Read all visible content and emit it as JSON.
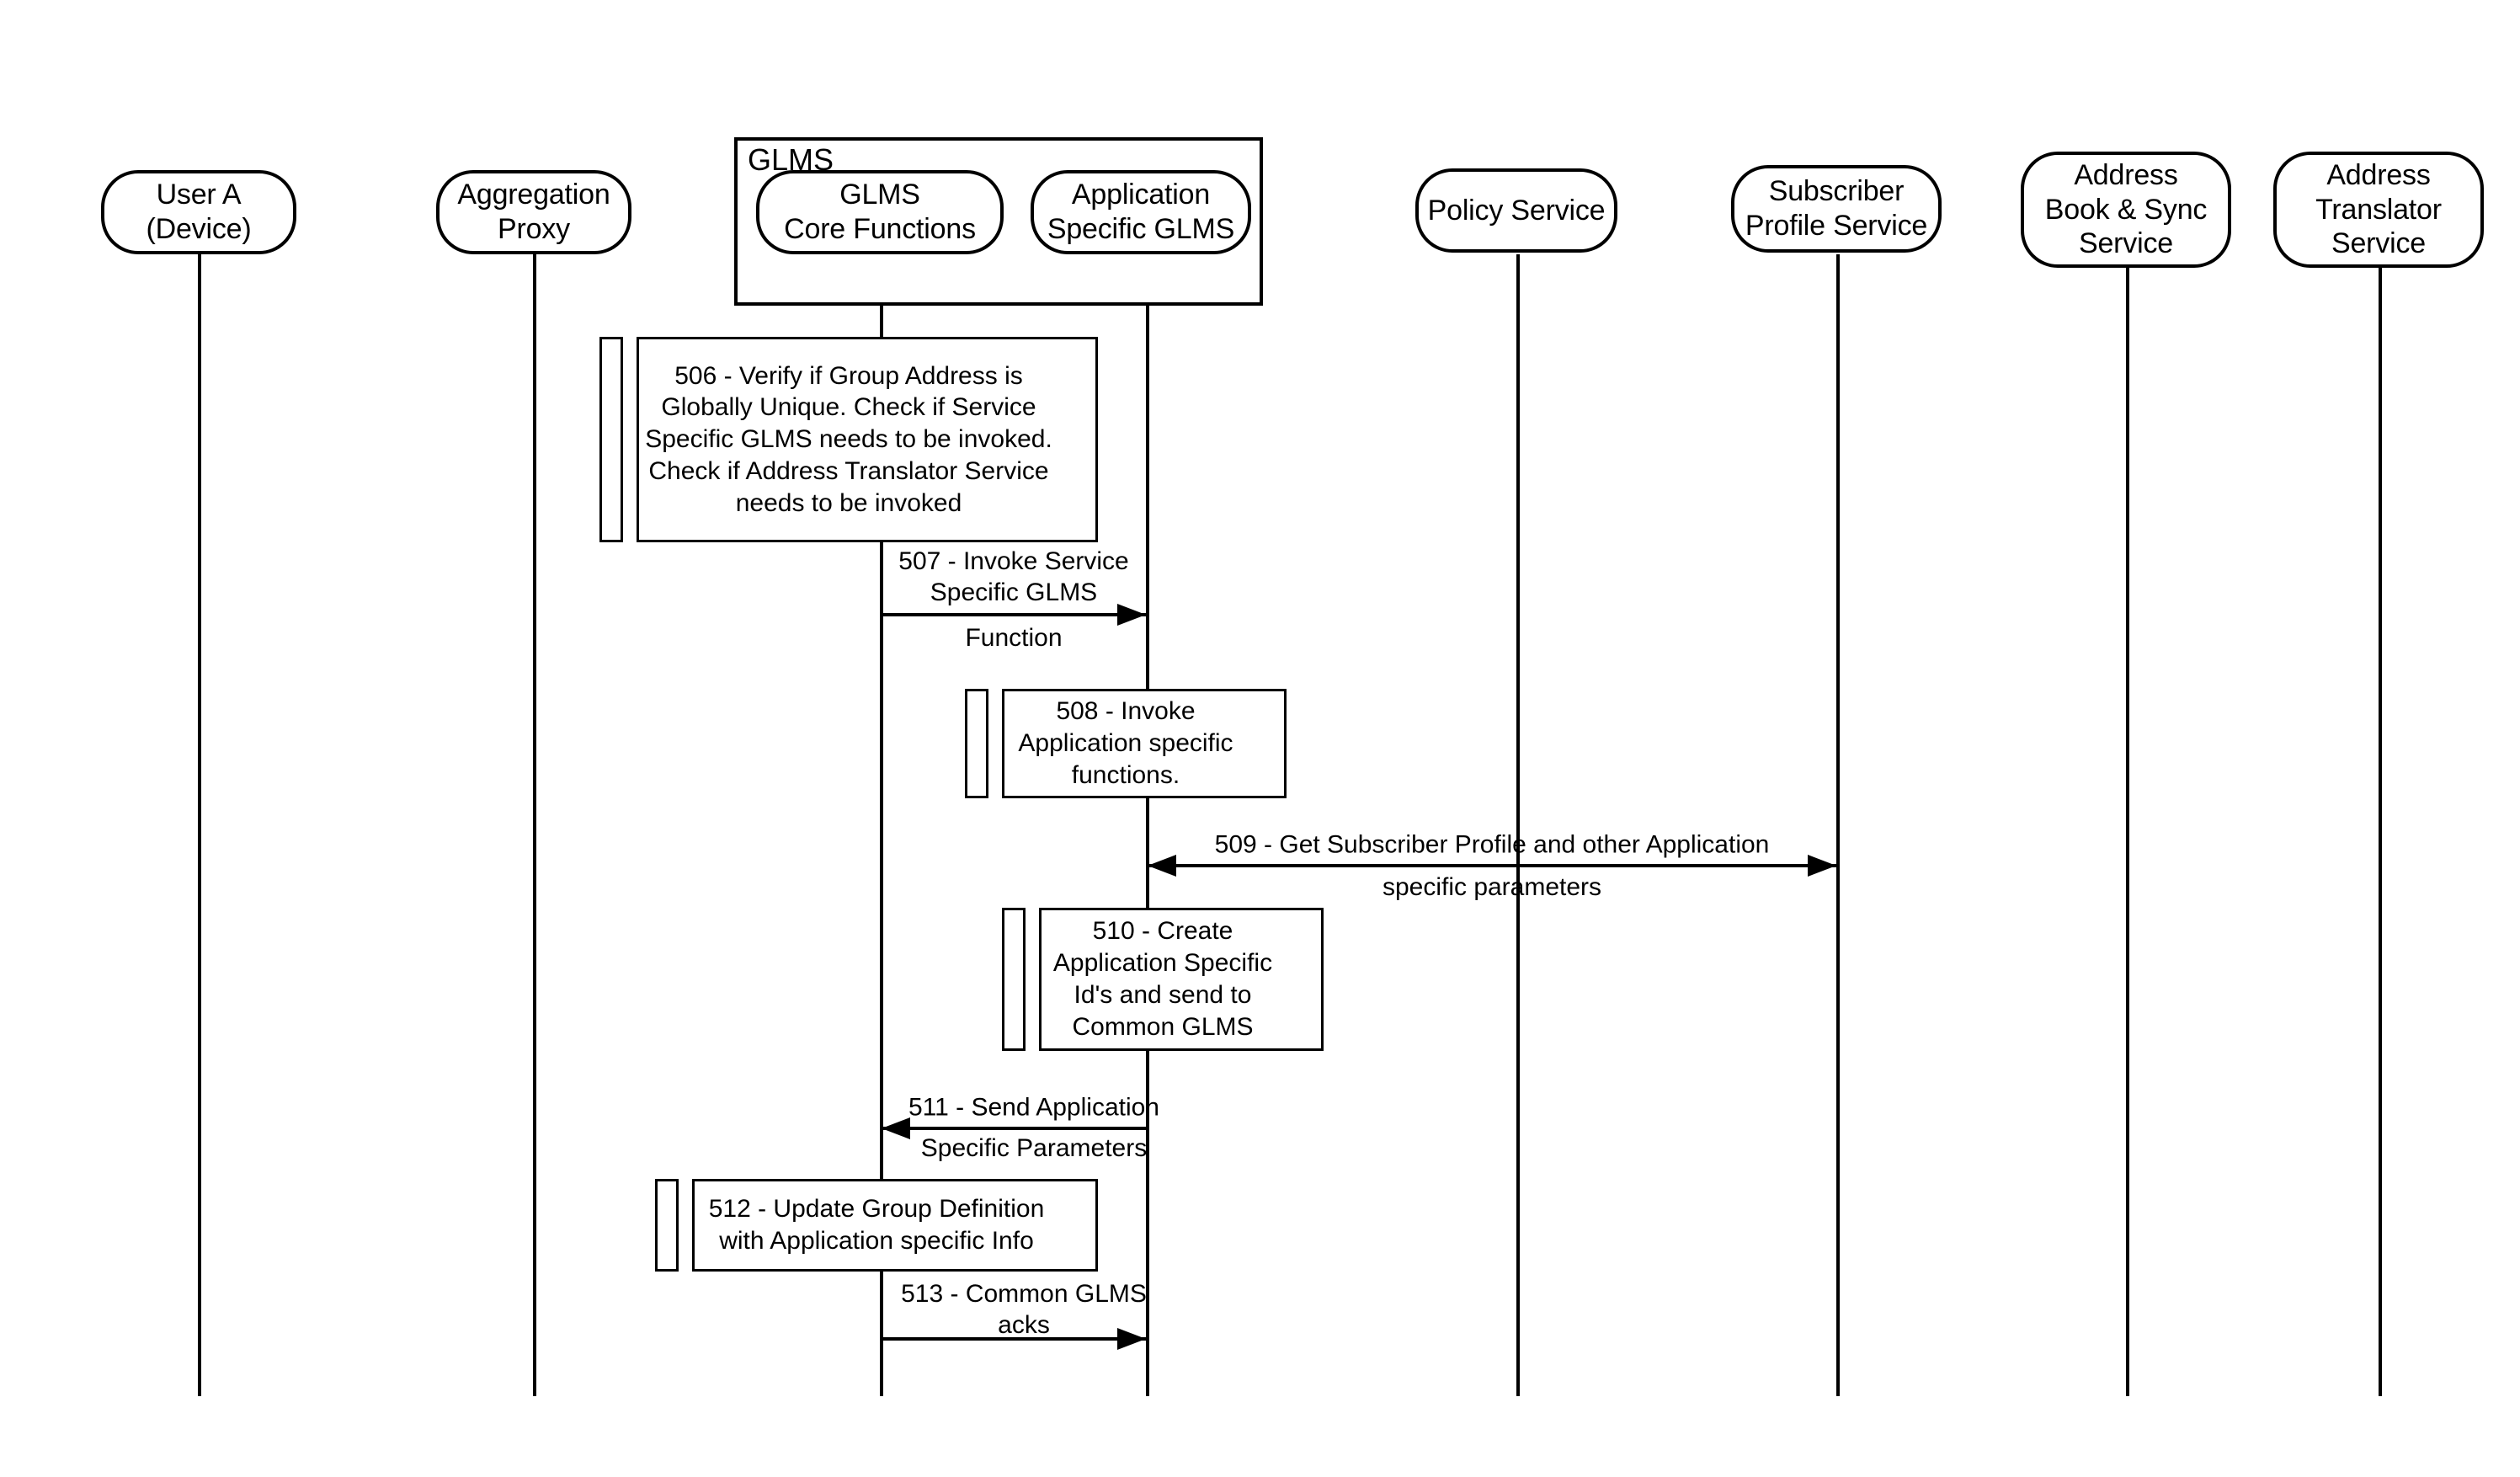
{
  "diagram": {
    "title": "GLMS Group Management Sequence Diagram",
    "group_frame_label": "GLMS",
    "background_color": "#ffffff",
    "line_color": "#000000"
  },
  "lifelines": [
    {
      "id": "user-a",
      "label": "User A\n(Device)"
    },
    {
      "id": "aggregation-proxy",
      "label": "Aggregation\nProxy"
    },
    {
      "id": "glms-core",
      "label": "GLMS\nCore Functions"
    },
    {
      "id": "app-specific-glms",
      "label": "Application\nSpecific GLMS"
    },
    {
      "id": "policy-service",
      "label": "Policy Service"
    },
    {
      "id": "subscriber-profile",
      "label": "Subscriber\nProfile Service"
    },
    {
      "id": "address-book-sync",
      "label": "Address\nBook & Sync\nService"
    },
    {
      "id": "address-translator",
      "label": "Address\nTranslator\nService"
    }
  ],
  "notes": [
    {
      "id": "note-506",
      "step": "506",
      "on": "glms-core",
      "text": "506 - Verify if Group Address is\nGlobally Unique. Check if Service\nSpecific GLMS needs to be invoked.\nCheck if Address Translator Service\nneeds to be invoked"
    },
    {
      "id": "note-508",
      "step": "508",
      "on": "app-specific-glms",
      "text": "508 - Invoke\nApplication specific\nfunctions."
    },
    {
      "id": "note-510",
      "step": "510",
      "on": "app-specific-glms",
      "text": "510 - Create\nApplication Specific\nId's and send to\nCommon GLMS"
    },
    {
      "id": "note-512",
      "step": "512",
      "on": "glms-core",
      "text": "512 - Update Group Definition\nwith Application specific Info"
    }
  ],
  "messages": [
    {
      "id": "msg-507",
      "step": "507",
      "from": "glms-core",
      "to": "app-specific-glms",
      "direction": "right",
      "label_above": "507 - Invoke Service\nSpecific GLMS",
      "label_below": "Function"
    },
    {
      "id": "msg-509",
      "step": "509",
      "from": "app-specific-glms",
      "to": "subscriber-profile",
      "direction": "both",
      "label_above": "509 - Get Subscriber Profile and other Application",
      "label_below": "specific parameters"
    },
    {
      "id": "msg-511",
      "step": "511",
      "from": "app-specific-glms",
      "to": "glms-core",
      "direction": "left",
      "label_above": "511 - Send Application",
      "label_below": "Specific Parameters"
    },
    {
      "id": "msg-513",
      "step": "513",
      "from": "glms-core",
      "to": "app-specific-glms",
      "direction": "right",
      "label_above": "513 - Common GLMS\nacks",
      "label_below": ""
    }
  ]
}
